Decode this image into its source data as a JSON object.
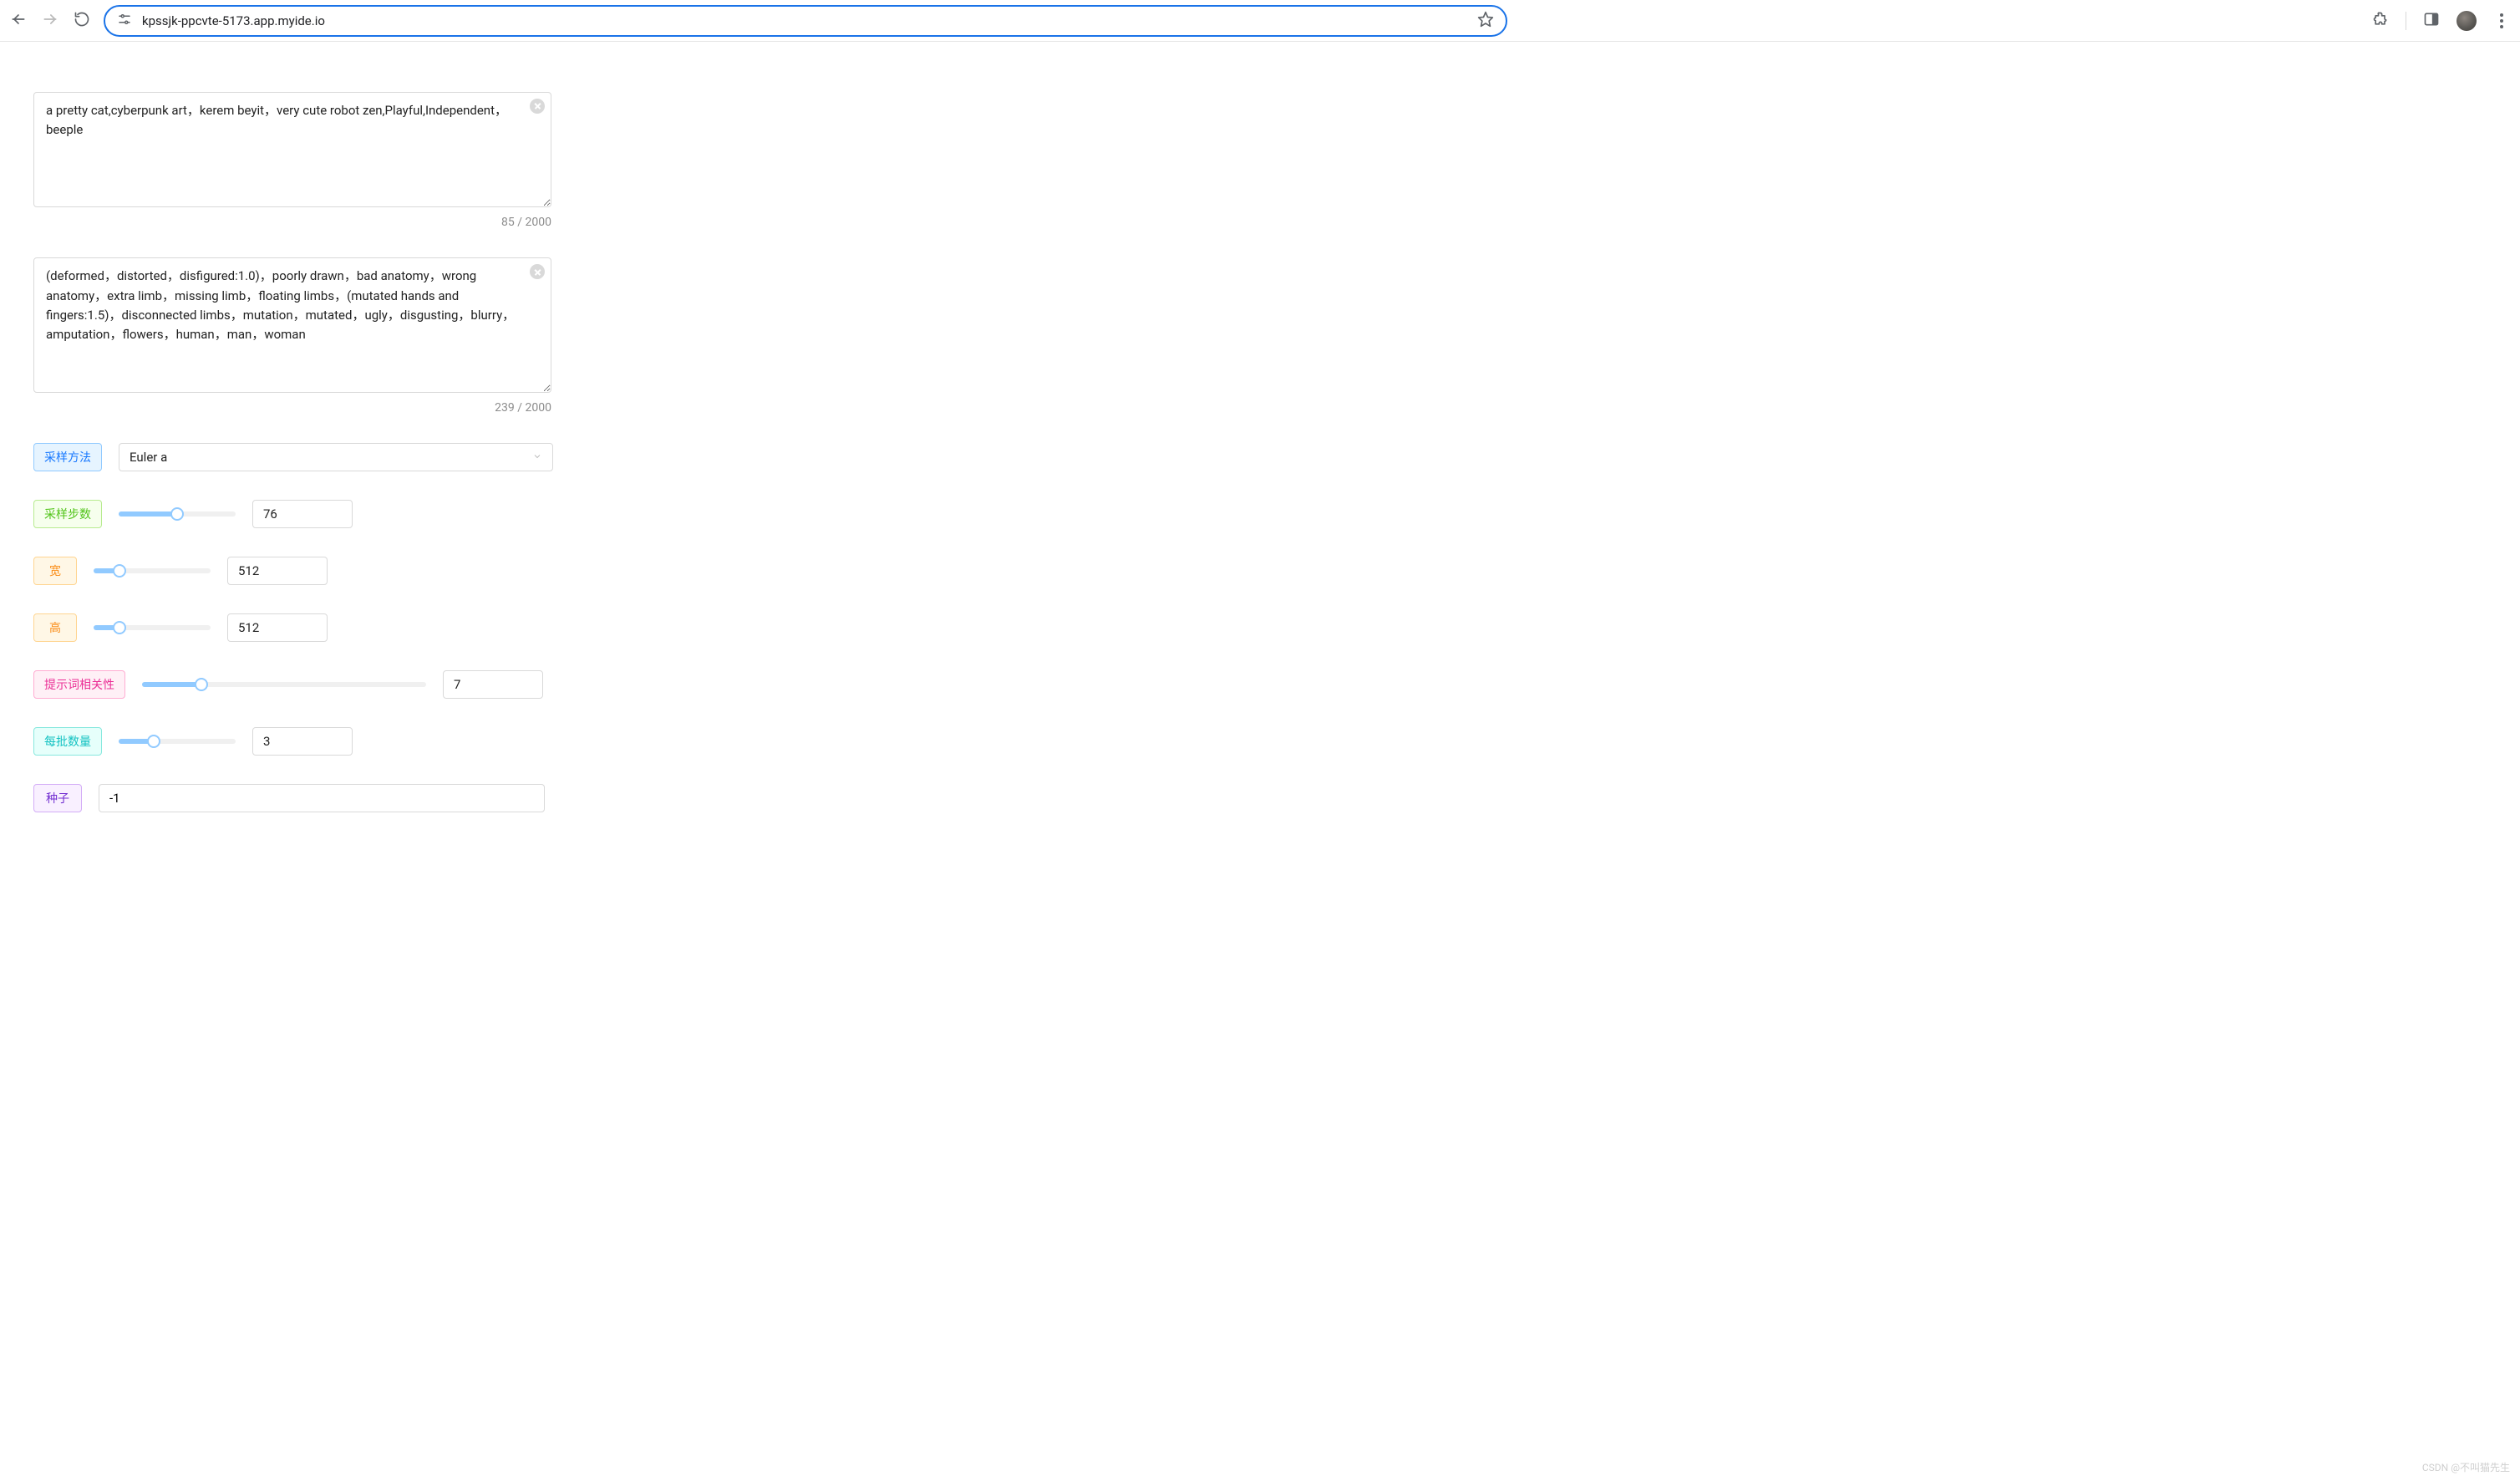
{
  "chrome": {
    "url": "kpssjk-ppcvte-5173.app.myide.io"
  },
  "prompt": {
    "value": "a pretty cat,cyberpunk art，kerem beyit，very cute robot zen,Playful,Independent，beeple",
    "count": 85,
    "max": 2000
  },
  "neg_prompt": {
    "value": "(deformed，distorted，disfigured:1.0)，poorly drawn，bad anatomy，wrong anatomy，extra limb，missing limb，floating limbs，(mutated hands and fingers:1.5)，disconnected limbs，mutation，mutated，ugly，disgusting，blurry，amputation，flowers，human，man，woman",
    "count": 239,
    "max": 2000
  },
  "sampler": {
    "label": "采样方法",
    "value": "Euler a"
  },
  "steps": {
    "label": "采样步数",
    "value": 76,
    "min": 1,
    "max": 150,
    "percent": 50
  },
  "width": {
    "label": "宽",
    "value": 512,
    "min": 64,
    "max": 2048,
    "percent": 22
  },
  "height": {
    "label": "高",
    "value": 512,
    "min": 64,
    "max": 2048,
    "percent": 22
  },
  "cfg": {
    "label": "提示词相关性",
    "value": 7,
    "min": 1,
    "max": 30,
    "percent": 21
  },
  "batch": {
    "label": "每批数量",
    "value": 3,
    "min": 1,
    "max": 8,
    "percent": 30
  },
  "seed": {
    "label": "种子",
    "value": "-1"
  },
  "watermark": "CSDN @不叫猫先生"
}
